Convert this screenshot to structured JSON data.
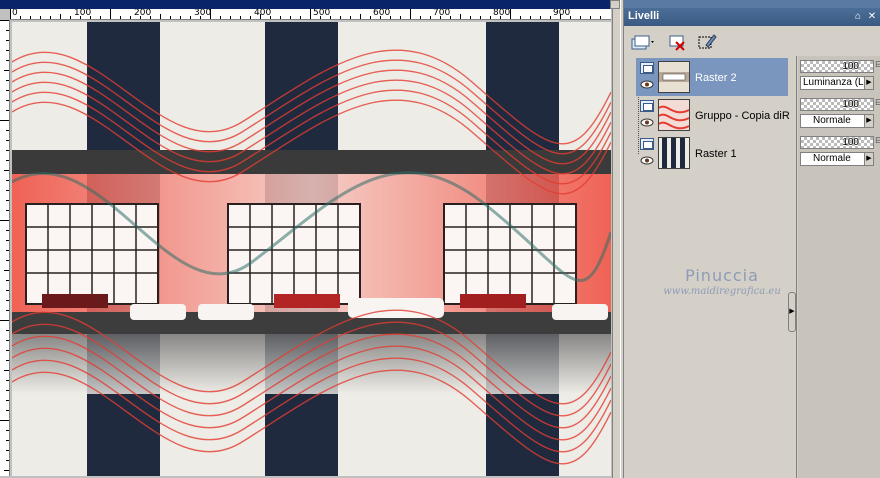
{
  "canvas": {
    "ruler_labels": [
      "0",
      "100",
      "200",
      "300",
      "400",
      "500",
      "600",
      "700",
      "800",
      "900"
    ]
  },
  "palette": {
    "title": "Livelli",
    "pin_glyph": "⌂",
    "close_glyph": "✕"
  },
  "toolbar": {
    "new_layer_icon": "new-layer-icon",
    "delete_layer_icon": "delete-layer-icon",
    "edit_selection_icon": "edit-selection-icon"
  },
  "layers": [
    {
      "name": "Raster 2",
      "opacity": "100",
      "blend_mode": "Luminanza (L)",
      "selected": true
    },
    {
      "name": "Gruppo - Copia diRaster",
      "opacity": "100",
      "blend_mode": "Normale",
      "selected": false
    },
    {
      "name": "Raster 1",
      "opacity": "100",
      "blend_mode": "Normale",
      "selected": false
    }
  ],
  "watermark": {
    "name": "Pinuccia",
    "url": "www.maidiregrafica.eu"
  },
  "colors": {
    "navy_stripe": "#1f2a3f",
    "red_wave": "#e33c32",
    "selection": "#7a96bf"
  }
}
